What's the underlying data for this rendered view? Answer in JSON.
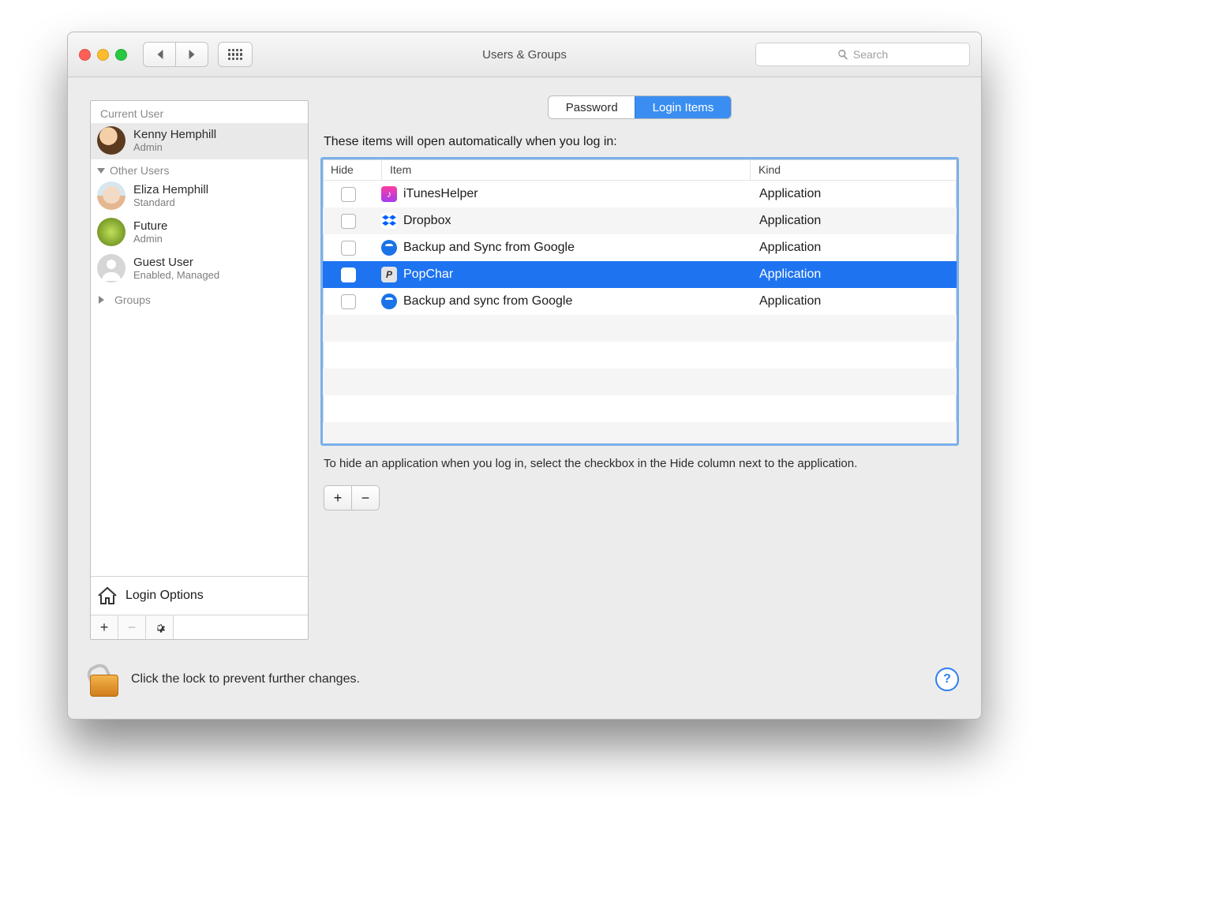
{
  "window": {
    "title": "Users & Groups"
  },
  "search": {
    "placeholder": "Search"
  },
  "sidebar": {
    "current_label": "Current User",
    "other_label": "Other Users",
    "groups_label": "Groups",
    "login_options_label": "Login Options",
    "current": {
      "name": "Kenny Hemphill",
      "role": "Admin"
    },
    "others": [
      {
        "name": "Eliza Hemphill",
        "role": "Standard"
      },
      {
        "name": "Future",
        "role": "Admin"
      },
      {
        "name": "Guest User",
        "role": "Enabled, Managed"
      }
    ]
  },
  "tabs": {
    "password": "Password",
    "login_items": "Login Items"
  },
  "main": {
    "description": "These items will open automatically when you log in:",
    "columns": {
      "hide": "Hide",
      "item": "Item",
      "kind": "Kind"
    },
    "rows": [
      {
        "name": "iTunesHelper",
        "kind": "Application",
        "icon": "itunes",
        "selected": false
      },
      {
        "name": "Dropbox",
        "kind": "Application",
        "icon": "dropbox",
        "selected": false
      },
      {
        "name": "Backup and Sync from Google",
        "kind": "Application",
        "icon": "google",
        "selected": false
      },
      {
        "name": "PopChar",
        "kind": "Application",
        "icon": "popchar",
        "selected": true
      },
      {
        "name": "Backup and sync from Google",
        "kind": "Application",
        "icon": "google",
        "selected": false
      }
    ],
    "hint": "To hide an application when you log in, select the checkbox in the Hide column next to the application."
  },
  "lock": {
    "text": "Click the lock to prevent further changes."
  }
}
